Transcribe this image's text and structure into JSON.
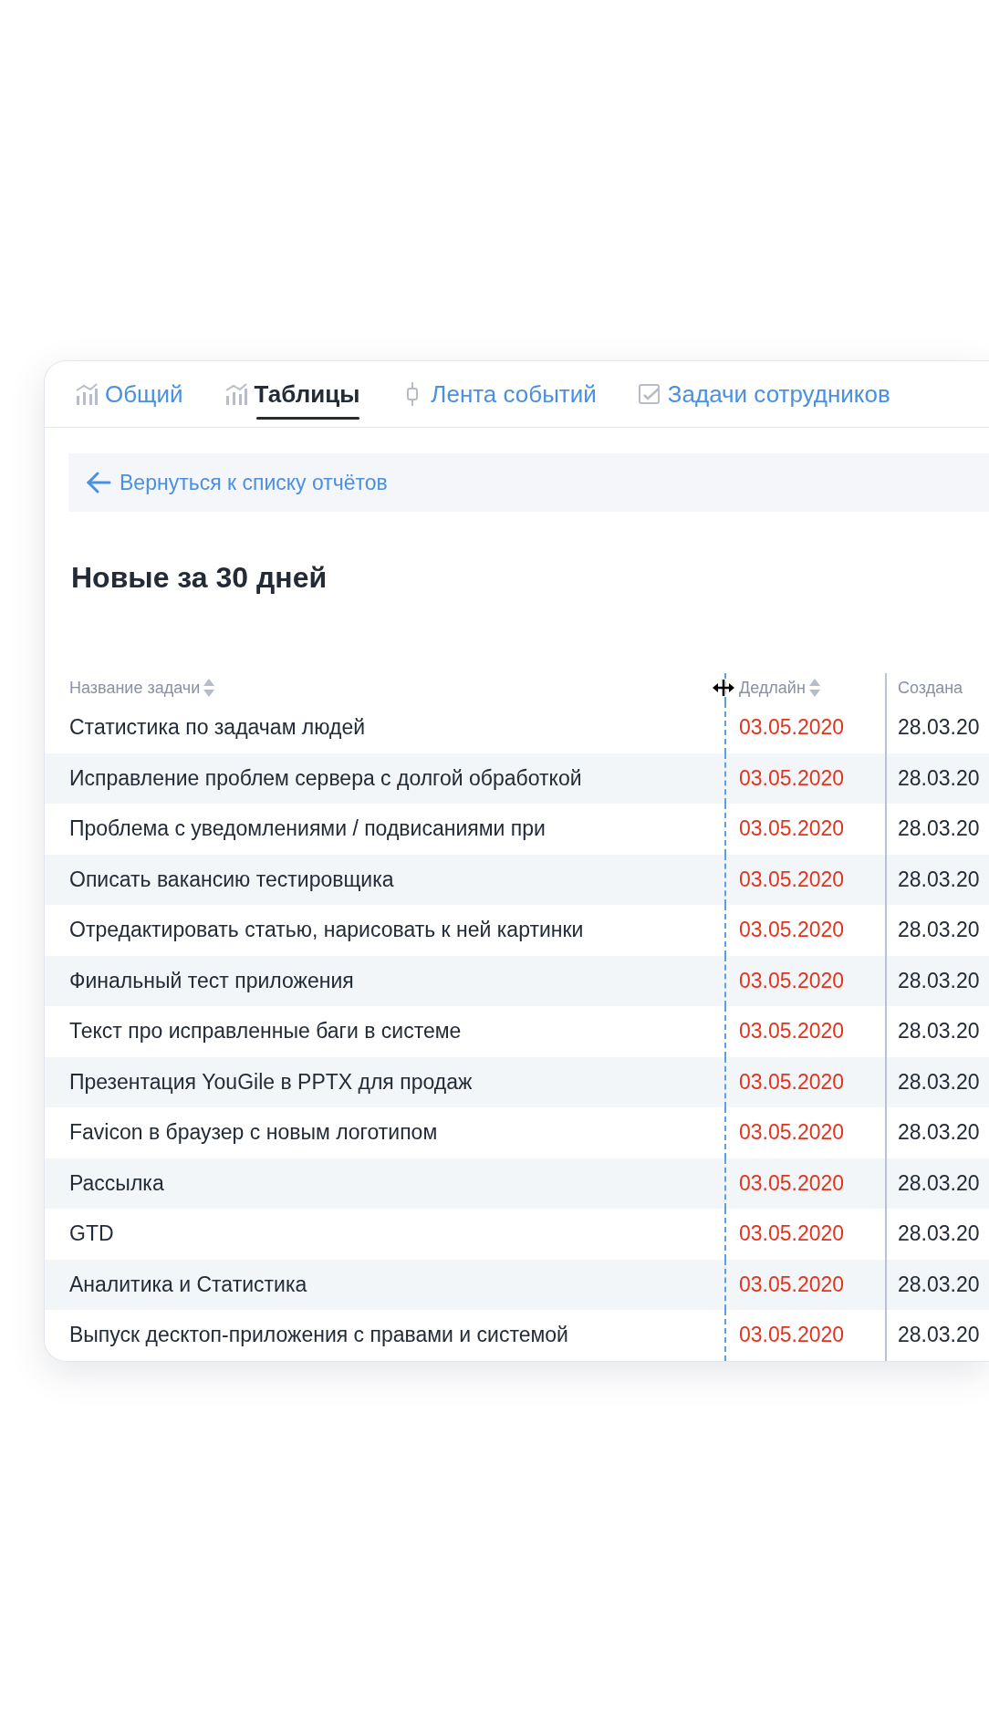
{
  "tabs": [
    {
      "label": "Общий",
      "kind": "chart",
      "selected": false
    },
    {
      "label": "Таблицы",
      "kind": "chart",
      "selected": true
    },
    {
      "label": "Лента событий",
      "kind": "feed",
      "selected": false
    },
    {
      "label": "Задачи сотрудников",
      "kind": "check",
      "selected": false
    }
  ],
  "back_link": "Вернуться к списку отчётов",
  "title": "Новые за 30 дней",
  "table": {
    "columns": [
      {
        "label": "Название задачи",
        "sortable": true
      },
      {
        "label": "Дедлайн",
        "sortable": true
      },
      {
        "label": "Создана",
        "sortable": false
      }
    ],
    "rows": [
      {
        "name": "Статистика по задачам людей",
        "deadline": "03.05.2020",
        "overdue": true,
        "created": "28.03.20"
      },
      {
        "name": "Исправление проблем сервера с долгой обработкой",
        "deadline": "03.05.2020",
        "overdue": true,
        "created": "28.03.20"
      },
      {
        "name": "Проблема с уведомлениями / подвисаниями при",
        "deadline": "03.05.2020",
        "overdue": true,
        "created": "28.03.20"
      },
      {
        "name": "Описать вакансию тестировщика",
        "deadline": "03.05.2020",
        "overdue": true,
        "created": "28.03.20"
      },
      {
        "name": "Отредактировать статью, нарисовать к ней картинки",
        "deadline": "03.05.2020",
        "overdue": true,
        "created": "28.03.20"
      },
      {
        "name": "Финальный тест приложения",
        "deadline": "03.05.2020",
        "overdue": true,
        "created": "28.03.20"
      },
      {
        "name": "Текст про исправленные баги в системе",
        "deadline": "03.05.2020",
        "overdue": true,
        "created": "28.03.20"
      },
      {
        "name": "Презентация YouGile в PPTX для продаж",
        "deadline": "03.05.2020",
        "overdue": true,
        "created": "28.03.20"
      },
      {
        "name": "Favicon в браузер с новым логотипом",
        "deadline": "03.05.2020",
        "overdue": true,
        "created": "28.03.20"
      },
      {
        "name": "Рассылка",
        "deadline": "03.05.2020",
        "overdue": true,
        "created": "28.03.20"
      },
      {
        "name": "GTD",
        "deadline": "03.05.2020",
        "overdue": true,
        "created": "28.03.20"
      },
      {
        "name": "Аналитика и Статистика",
        "deadline": "03.05.2020",
        "overdue": true,
        "created": "28.03.20"
      },
      {
        "name": "Выпуск десктоп-приложения с правами и системой",
        "deadline": "03.05.2020",
        "overdue": true,
        "created": "28.03.20"
      }
    ]
  }
}
